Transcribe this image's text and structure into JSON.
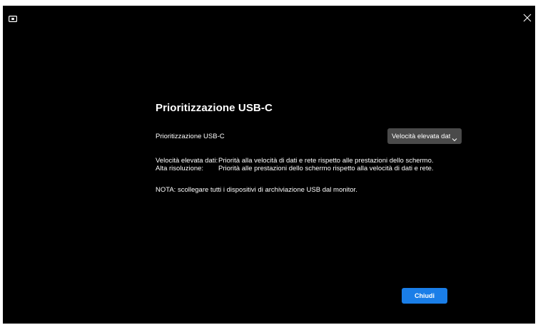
{
  "window": {
    "icons": {
      "app": "monitor-icon",
      "close": "close-icon"
    }
  },
  "panel": {
    "title": "Prioritizzazione USB-C",
    "setting_label": "Prioritizzazione USB-C",
    "dropdown": {
      "selected_value": "Velocità elevata dati",
      "icon": "chevron-down-icon"
    },
    "descriptions": [
      {
        "key": "Velocità elevata dati:",
        "text": "Priorità alla velocità di dati e rete rispetto alle prestazioni dello schermo."
      },
      {
        "key": "Alta risoluzione:",
        "text": "Priorità alle prestazioni dello schermo rispetto alla velocità di dati e rete."
      }
    ],
    "note": "NOTA: scollegare tutti i dispositivi di archiviazione USB dal monitor.",
    "close_button_label": "Chiudi"
  },
  "colors": {
    "background": "#000000",
    "dropdown_bg": "#4a4a4a",
    "primary_button": "#1a7ee8",
    "text": "#ffffff"
  }
}
